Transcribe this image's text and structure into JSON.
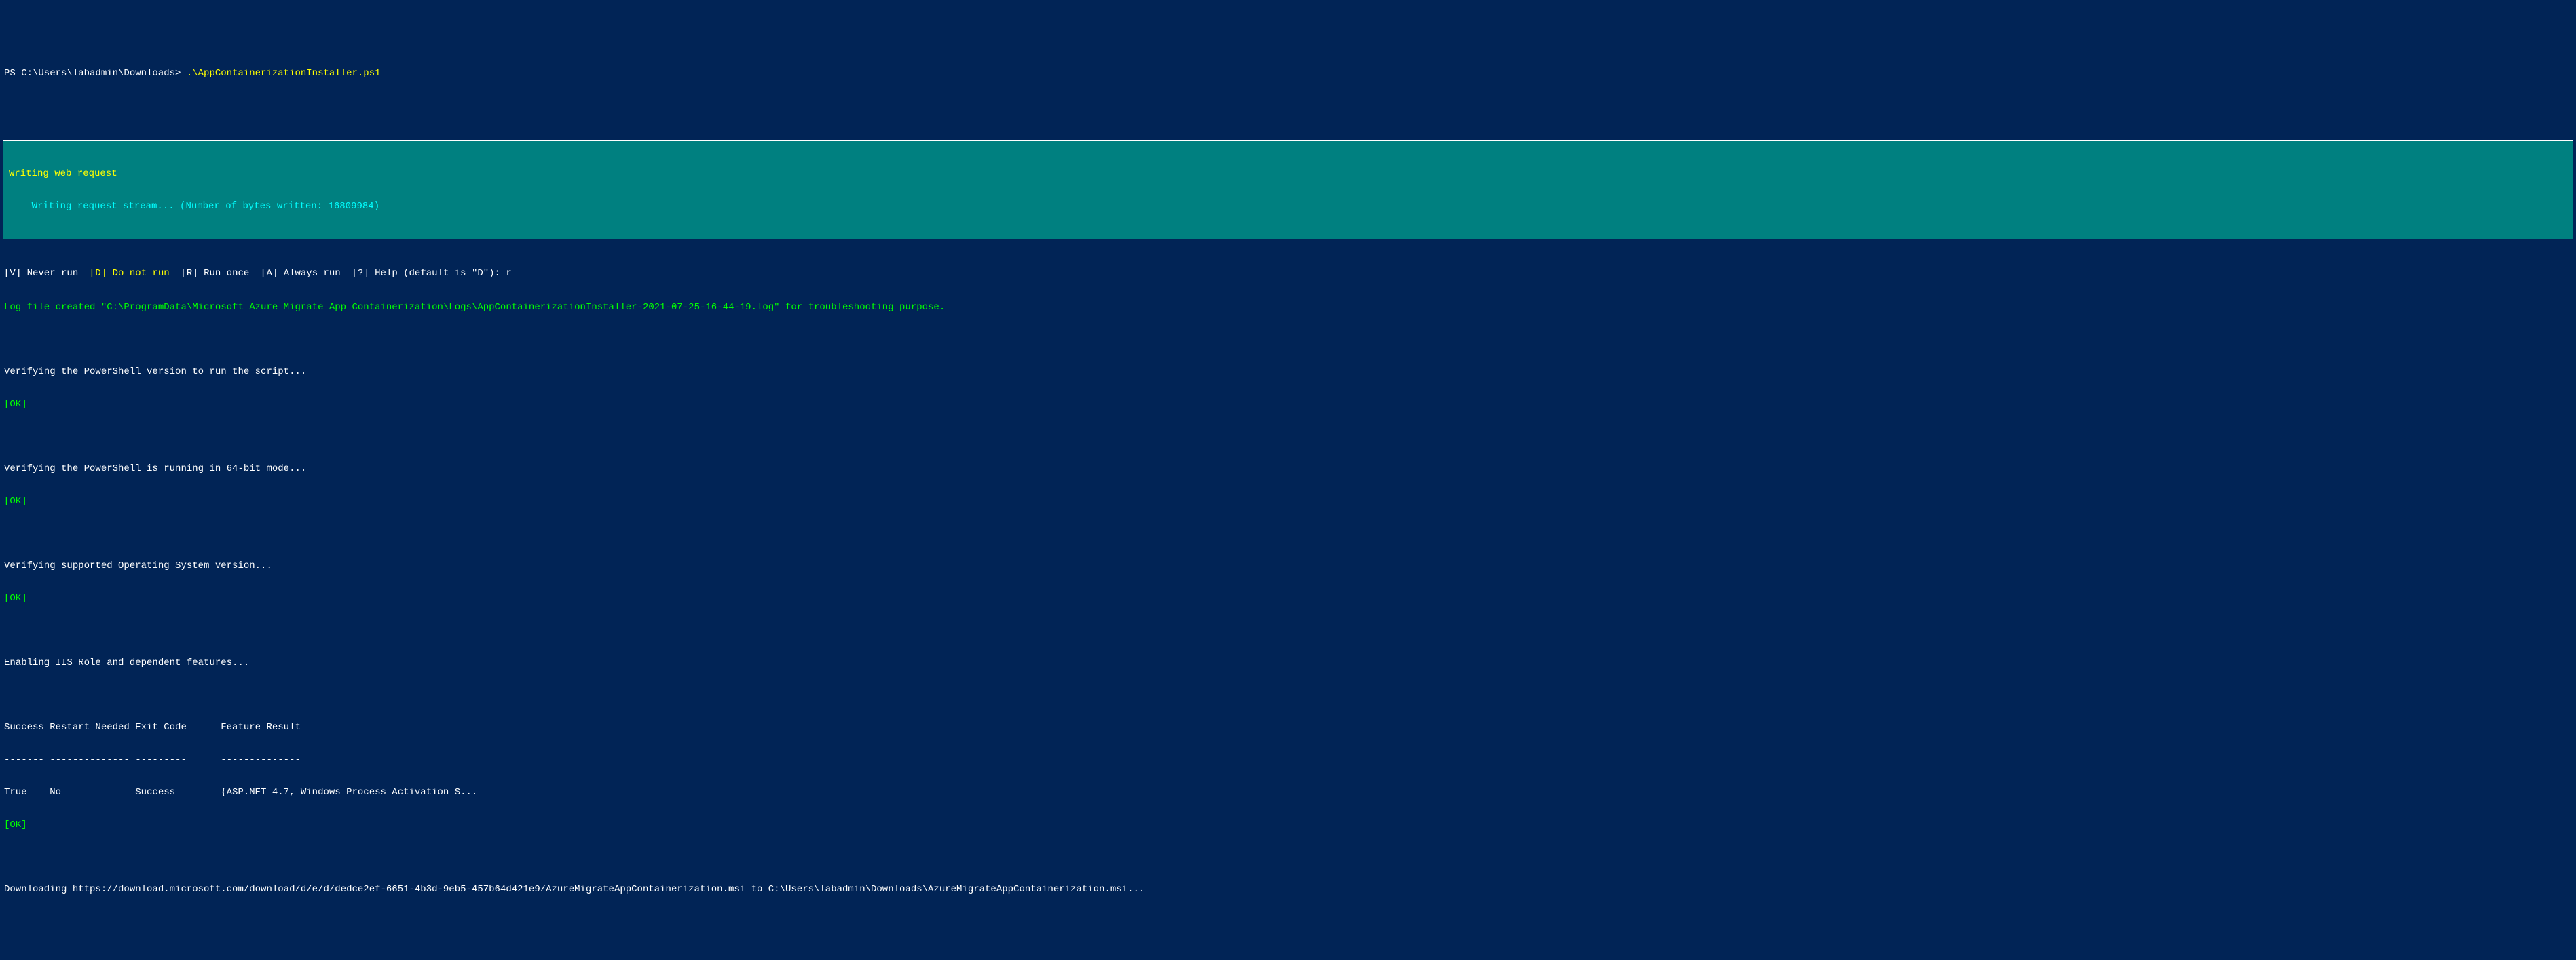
{
  "prompt": {
    "path": "PS C:\\Users\\labadmin\\Downloads> ",
    "command": ".\\AppContainerizationInstaller.ps1"
  },
  "progress": {
    "title": "Writing web request",
    "detail": "    Writing request stream... (Number of bytes written: 16809984)"
  },
  "choice": {
    "v": "[V] Never run  ",
    "d_bracket": "[D] ",
    "d_text": "Do not run  ",
    "r": "[R] Run once  ",
    "a": "[A] Always run  ",
    "help": "[?] Help (default is \"D\"): ",
    "input": "r"
  },
  "log_message": "Log file created \"C:\\ProgramData\\Microsoft Azure Migrate App Containerization\\Logs\\AppContainerizationInstaller-2021-07-25-16-44-19.log\" for troubleshooting purpose.",
  "verify1": "Verifying the PowerShell version to run the script...",
  "ok1": "[OK]",
  "verify2": "Verifying the PowerShell is running in 64-bit mode...",
  "ok2": "[OK]",
  "verify3": "Verifying supported Operating System version...",
  "ok3": "[OK]",
  "iis_enable": "Enabling IIS Role and dependent features...",
  "table": {
    "header": "Success Restart Needed Exit Code      Feature Result",
    "divider": "------- -------------- ---------      --------------",
    "row": "True    No             Success        {ASP.NET 4.7, Windows Process Activation S..."
  },
  "ok4": "[OK]",
  "download": "Downloading https://download.microsoft.com/download/d/e/d/dedce2ef-6651-4b3d-9eb5-457b64d421e9/AzureMigrateAppContainerization.msi to C:\\Users\\labadmin\\Downloads\\AzureMigrateAppContainerization.msi..."
}
